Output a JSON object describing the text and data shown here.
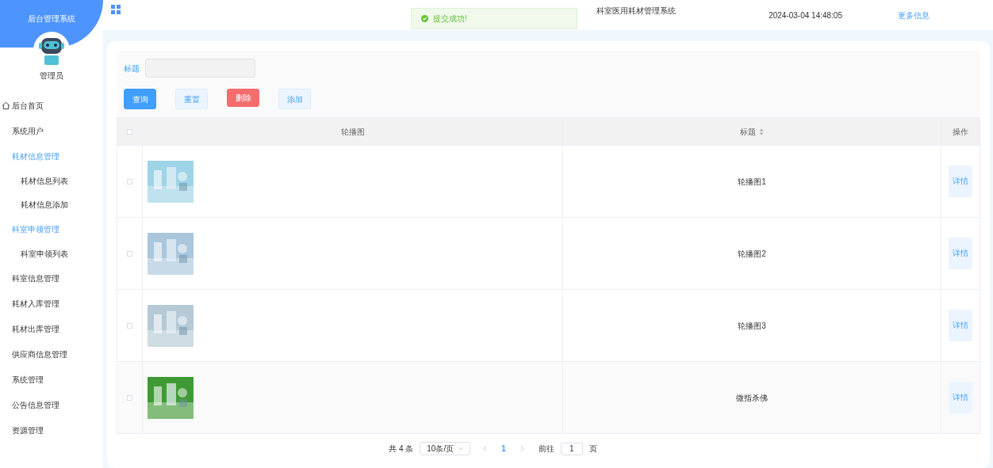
{
  "sidebar": {
    "system_name": "后台管理系统",
    "user_name": "管理员",
    "items": [
      {
        "label": "后台首页",
        "kind": "home",
        "expanded": false
      },
      {
        "label": "系统用户",
        "kind": "plain",
        "expanded": false
      },
      {
        "label": "耗材信息管理",
        "kind": "plain",
        "expanded": true,
        "children": [
          {
            "label": "耗材信息列表"
          },
          {
            "label": "耗材信息添加"
          }
        ]
      },
      {
        "label": "科室申领管理",
        "kind": "plain",
        "expanded": true,
        "children": [
          {
            "label": "科室申领列表"
          }
        ]
      },
      {
        "label": "科室信息管理",
        "kind": "plain",
        "expanded": false
      },
      {
        "label": "耗材入库管理",
        "kind": "plain",
        "expanded": false
      },
      {
        "label": "耗材出库管理",
        "kind": "plain",
        "expanded": false
      },
      {
        "label": "供应商信息管理",
        "kind": "plain",
        "expanded": false
      },
      {
        "label": "系统管理",
        "kind": "plain",
        "expanded": false
      },
      {
        "label": "公告信息管理",
        "kind": "plain",
        "expanded": false
      },
      {
        "label": "资源管理",
        "kind": "plain",
        "expanded": false
      }
    ]
  },
  "header": {
    "title": "科室医用耗材管理系统",
    "datetime": "2024-03-04 14:48:05",
    "more_link": "更多信息"
  },
  "toast": {
    "message": "提交成功!"
  },
  "search": {
    "label": "标题"
  },
  "buttons": [
    {
      "label": "查询",
      "kind": "primary"
    },
    {
      "label": "重置",
      "kind": "plain"
    },
    {
      "label": "删除",
      "kind": "danger"
    },
    {
      "label": "添加",
      "kind": "plain"
    }
  ],
  "table": {
    "select_all_checked": false,
    "columns": [
      "轮播图",
      "标题",
      "操作"
    ],
    "rows": [
      {
        "checked": false,
        "title": "轮播图1",
        "action": "详情"
      },
      {
        "checked": false,
        "title": "轮播图2",
        "action": "详情"
      },
      {
        "checked": false,
        "title": "轮播图3",
        "action": "详情"
      },
      {
        "checked": false,
        "title": "微指杀佛",
        "action": "详情"
      }
    ]
  },
  "pagination": {
    "total": "共 4 条",
    "page_size": "10条/页",
    "current": "1",
    "goto_label": "前往",
    "goto_value": "1",
    "page_suffix": "页"
  }
}
